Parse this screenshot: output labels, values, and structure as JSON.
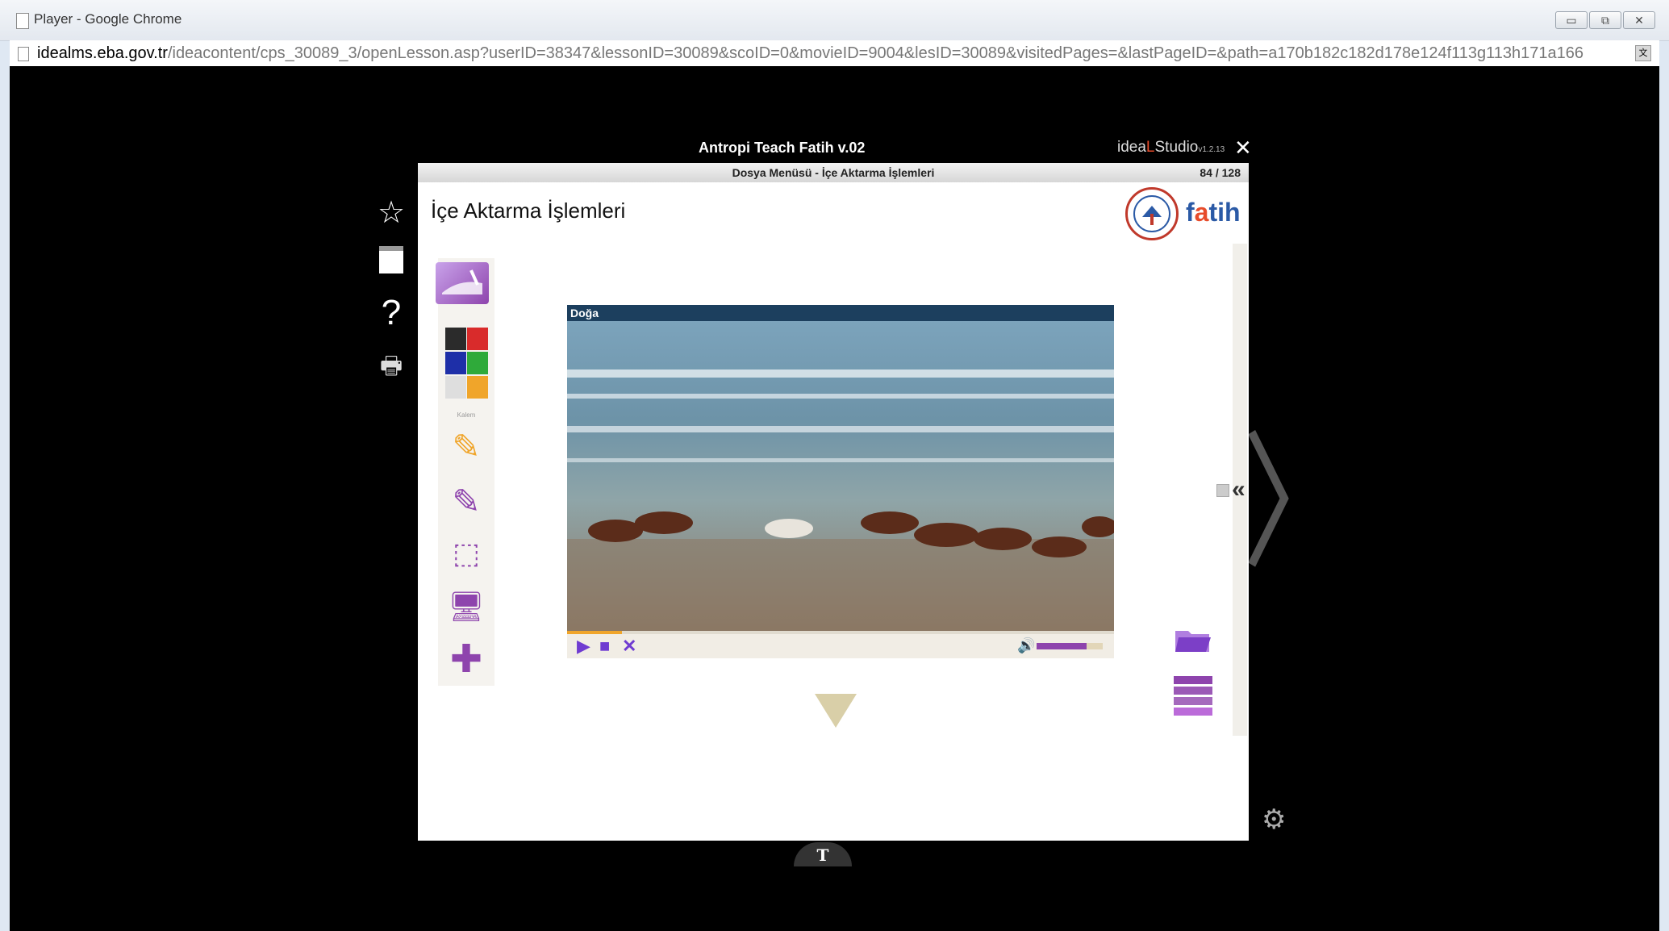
{
  "browser": {
    "window_title": "Player - Google Chrome",
    "url_host": "idealms.eba.gov.tr",
    "url_path": "/ideacontent/cps_30089_3/openLesson.asp?userID=38347&lessonID=30089&scoID=0&movieID=9004&lesID=30089&visitedPages=&lastPageID=&path=a170b182c182d178e124f113g113h171a166",
    "min_label": "▭",
    "max_label": "⧉",
    "close_label": "✕"
  },
  "player": {
    "title": "Antropi Teach Fatih v.02",
    "brand_prefix": "idea",
    "brand_l": "L",
    "brand_suffix": "Studio",
    "brand_version": "v1.2.13",
    "close": "✕",
    "subtitle": "Dosya Menüsü - İçe Aktarma İşlemleri",
    "page_counter": "84 / 128",
    "lesson_title": "İçe Aktarma İşlemleri"
  },
  "logos": {
    "fatih_f": "f",
    "fatih_a": "a",
    "fatih_rest": "tih"
  },
  "sidebar": {
    "star": "☆",
    "help": "?",
    "print": "🖶"
  },
  "nav": {
    "prev": "〈",
    "next": "〉",
    "collapse": "«"
  },
  "tools": {
    "label": "Kalem",
    "colors": [
      "#2b2b2b",
      "#d92b2b",
      "#1e2fa8",
      "#2faa3a",
      "#dedede",
      "#f0a52a"
    ],
    "pen": "✎",
    "eraser": "✎",
    "select": "⬚",
    "screen": "🖥",
    "add": "✚"
  },
  "video": {
    "title": "Doğa",
    "progress": 0.1,
    "volume": 0.75,
    "play": "▶",
    "stop": "■",
    "close": "✕",
    "volume_icon": "🔊"
  },
  "footer": {
    "tab_label": "T",
    "gear": "⚙"
  },
  "colors": {
    "accent": "#6f3bd1",
    "purple": "#8e44ad",
    "orange": "#f0a52a"
  }
}
